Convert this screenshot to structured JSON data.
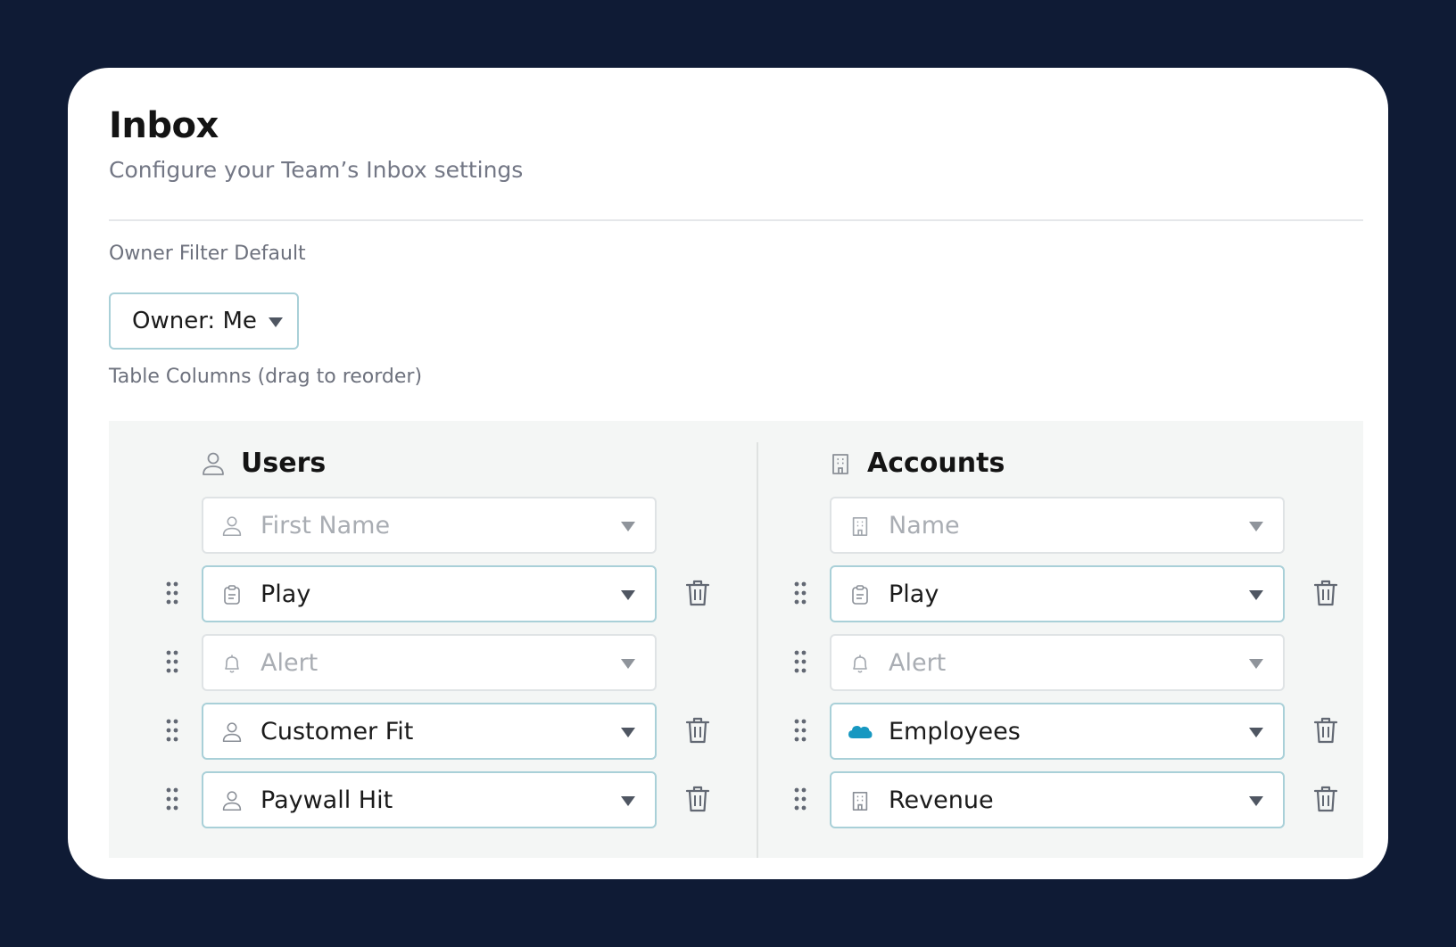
{
  "header": {
    "title": "Inbox",
    "subtitle": "Configure your Team’s Inbox settings"
  },
  "owner_filter": {
    "label": "Owner Filter Default",
    "value": "Owner: Me"
  },
  "table_columns": {
    "label": "Table Columns (drag to reorder)",
    "users": {
      "heading": "Users",
      "rows": [
        {
          "text": "First Name",
          "icon": "person-icon",
          "disabled": true
        },
        {
          "text": "Play",
          "icon": "clipboard-icon",
          "disabled": false
        },
        {
          "text": "Alert",
          "icon": "bell-icon",
          "disabled": true
        },
        {
          "text": "Customer Fit",
          "icon": "person-icon",
          "disabled": false
        },
        {
          "text": "Paywall Hit",
          "icon": "person-icon",
          "disabled": false
        }
      ]
    },
    "accounts": {
      "heading": "Accounts",
      "rows": [
        {
          "text": "Name",
          "icon": "building-icon",
          "disabled": true
        },
        {
          "text": "Play",
          "icon": "clipboard-icon",
          "disabled": false
        },
        {
          "text": "Alert",
          "icon": "bell-icon",
          "disabled": true
        },
        {
          "text": "Employees",
          "icon": "salesforce-cloud-icon",
          "disabled": false
        },
        {
          "text": "Revenue",
          "icon": "building-icon",
          "disabled": false
        }
      ]
    }
  },
  "colors": {
    "background": "#0f1b35",
    "field_border": "#a9d0d8",
    "panel": "#f4f6f5",
    "salesforce": "#1798c1"
  }
}
